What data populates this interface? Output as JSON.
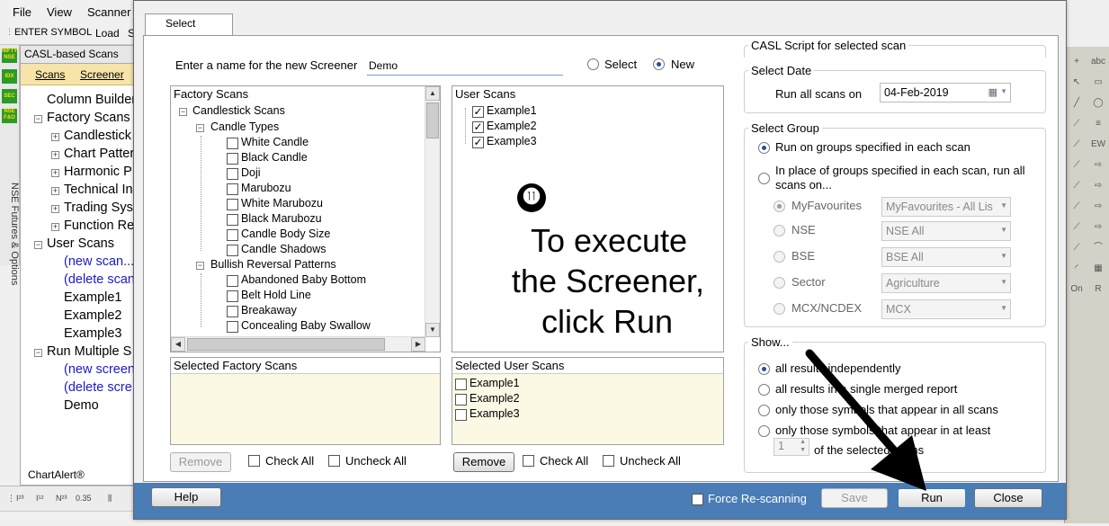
{
  "menu": [
    "File",
    "View",
    "Scanner"
  ],
  "toolbar": {
    "enter_symbol": "ENTER SYMBOL",
    "load": "Load",
    "extra": "S"
  },
  "left_strip": {
    "buttons": [
      {
        "label": "NIFTY NSE",
        "color": "#2a9a2a"
      },
      {
        "label": "IDX",
        "color": "#2a9a2a"
      },
      {
        "label": "SEC",
        "color": "#2a9a2a"
      },
      {
        "label": "NSE F&O",
        "color": "#2a9a2a"
      }
    ],
    "vertical_label": "NSE Futures & Options"
  },
  "left_panel": {
    "header": "CASL-based Scans",
    "tabs": [
      "Scans",
      "Screener"
    ],
    "tree": [
      {
        "label": "Column Builder",
        "level": 0,
        "blue": false
      },
      {
        "label": "Factory Scans",
        "level": 0,
        "blue": false
      },
      {
        "label": "Candlestick",
        "level": 1,
        "blue": false
      },
      {
        "label": "Chart Patterns",
        "level": 1,
        "blue": false
      },
      {
        "label": "Harmonic P",
        "level": 1,
        "blue": false
      },
      {
        "label": "Technical In",
        "level": 1,
        "blue": false
      },
      {
        "label": "Trading Sys",
        "level": 1,
        "blue": false
      },
      {
        "label": "Function Re",
        "level": 1,
        "blue": false
      },
      {
        "label": "User Scans",
        "level": 0,
        "blue": false
      },
      {
        "label": "(new scan...",
        "level": 1,
        "blue": true
      },
      {
        "label": "(delete scan",
        "level": 1,
        "blue": true
      },
      {
        "label": "Example1",
        "level": 1,
        "blue": false
      },
      {
        "label": "Example2",
        "level": 1,
        "blue": false
      },
      {
        "label": "Example3",
        "level": 1,
        "blue": false
      },
      {
        "label": "Run Multiple S",
        "level": 0,
        "blue": false
      },
      {
        "label": "(new screen",
        "level": 1,
        "blue": true
      },
      {
        "label": "(delete scre",
        "level": 1,
        "blue": true
      },
      {
        "label": "Demo",
        "level": 1,
        "blue": false
      }
    ],
    "footer": "ChartAlert®"
  },
  "dialog": {
    "tab": "Select",
    "name_label": "Enter a name for the new Screener",
    "name_value": "Demo",
    "mode_options": [
      "Select",
      "New"
    ],
    "mode_selected": "New",
    "factory_scans": {
      "header": "Factory Scans",
      "root": "Candlestick Scans",
      "groups": [
        {
          "name": "Candle Types",
          "items": [
            "White Candle",
            "Black Candle",
            "Doji",
            "Marubozu",
            "White Marubozu",
            "Black Marubozu",
            "Candle Body Size",
            "Candle Shadows"
          ]
        },
        {
          "name": "Bullish Reversal Patterns",
          "items": [
            "Abandoned Baby Bottom",
            "Belt Hold Line",
            "Breakaway",
            "Concealing Baby Swallow"
          ]
        }
      ]
    },
    "user_scans": {
      "header": "User Scans",
      "items": [
        {
          "label": "Example1",
          "checked": true
        },
        {
          "label": "Example2",
          "checked": true
        },
        {
          "label": "Example3",
          "checked": true
        }
      ]
    },
    "selected_factory": {
      "header": "Selected Factory Scans"
    },
    "selected_user": {
      "header": "Selected User Scans",
      "items": [
        "Example1",
        "Example2",
        "Example3"
      ]
    },
    "remove_label": "Remove",
    "check_all": "Check All",
    "uncheck_all": "Uncheck All",
    "right": {
      "casl_title": "CASL Script for selected scan",
      "select_date": {
        "title": "Select Date",
        "label": "Run all scans on",
        "value": "04-Feb-2019"
      },
      "select_group": {
        "title": "Select Group",
        "option1": "Run on groups specified in each scan",
        "option2_line1": "In place of groups specified in each scan, run all",
        "option2_line2": "scans on...",
        "rows": [
          {
            "label": "MyFavourites",
            "value": "MyFavourites - All Lis",
            "selected": true
          },
          {
            "label": "NSE",
            "value": "NSE All",
            "selected": false
          },
          {
            "label": "BSE",
            "value": "BSE All",
            "selected": false
          },
          {
            "label": "Sector",
            "value": "Agriculture",
            "selected": false
          },
          {
            "label": "MCX/NCDEX",
            "value": "MCX",
            "selected": false
          }
        ]
      },
      "show": {
        "title": "Show...",
        "options": [
          "all results independently",
          "all results in a single merged report",
          "only those symbols that appear in all scans",
          "only those symbols that appear in at least"
        ],
        "selected_index": 0,
        "spinner_value": "1",
        "spinner_suffix": "of the selected scans"
      }
    },
    "footer": {
      "help": "Help",
      "force_rescan": "Force Re-scanning",
      "save": "Save",
      "run": "Run",
      "close": "Close"
    }
  },
  "annotation": {
    "number": "⓫",
    "lines": [
      "To execute",
      "the Screener,",
      "click Run"
    ]
  },
  "right_toolbar": {
    "icons": [
      "crosshair-icon",
      "abc-text-icon",
      "pointer-icon",
      "rectangle-icon",
      "line-icon",
      "ellipse-icon",
      "sl-tool-icon",
      "fib-icon",
      "sl-tool-icon",
      "ew-swing-icon",
      "sl-tool-icon",
      "arrow-icon",
      "sl-tool-icon",
      "arrow-icon",
      "sl-tool-icon",
      "arrow-icon",
      "sl-tool-icon",
      "arrow-icon",
      "sl-tool-icon",
      "fan-icon",
      "arc-icon",
      "grid-icon",
      "on-label-icon",
      "run-icon"
    ],
    "on_label": "On"
  }
}
